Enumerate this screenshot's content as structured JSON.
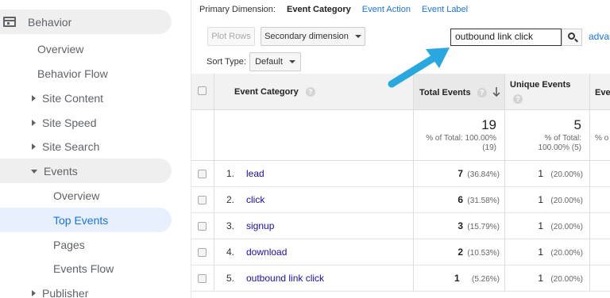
{
  "sidebar": {
    "behavior": "Behavior",
    "overview": "Overview",
    "behavior_flow": "Behavior Flow",
    "site_content": "Site Content",
    "site_speed": "Site Speed",
    "site_search": "Site Search",
    "events": "Events",
    "events_overview": "Overview",
    "top_events": "Top Events",
    "pages": "Pages",
    "events_flow": "Events Flow",
    "publisher": "Publisher"
  },
  "dimensions": {
    "label": "Primary Dimension:",
    "active": "Event Category",
    "option_action": "Event Action",
    "option_label": "Event Label"
  },
  "toolbar": {
    "plot_rows": "Plot Rows",
    "secondary_dimension": "Secondary dimension",
    "search_value": "outbound link click",
    "advanced": "advanced",
    "sort_type_label": "Sort Type:",
    "sort_type_value": "Default"
  },
  "table": {
    "headers": {
      "event_category": "Event Category",
      "total_events": "Total Events",
      "unique_events": "Unique Events",
      "next_col": "Eve"
    },
    "totals": {
      "total_events": "19",
      "total_events_pct_line1": "% of Total: 100.00%",
      "total_events_pct_line2": "(19)",
      "unique_events": "5",
      "unique_events_pct_line1": "% of Total:",
      "unique_events_pct_line2": "100.00% (5)",
      "next_col_pct": "% o"
    },
    "rows": [
      {
        "index": "1.",
        "category": "lead",
        "total": "7",
        "total_pct": "(36.84%)",
        "unique": "1",
        "unique_pct": "(20.00%)"
      },
      {
        "index": "2.",
        "category": "click",
        "total": "6",
        "total_pct": "(31.58%)",
        "unique": "1",
        "unique_pct": "(20.00%)"
      },
      {
        "index": "3.",
        "category": "signup",
        "total": "3",
        "total_pct": "(15.79%)",
        "unique": "1",
        "unique_pct": "(20.00%)"
      },
      {
        "index": "4.",
        "category": "download",
        "total": "2",
        "total_pct": "(10.53%)",
        "unique": "1",
        "unique_pct": "(20.00%)"
      },
      {
        "index": "5.",
        "category": "outbound link click",
        "total": "1",
        "total_pct": "(5.26%)",
        "unique": "1",
        "unique_pct": "(20.00%)"
      }
    ]
  },
  "annotation": {
    "arrow_color": "#29a8e0"
  }
}
